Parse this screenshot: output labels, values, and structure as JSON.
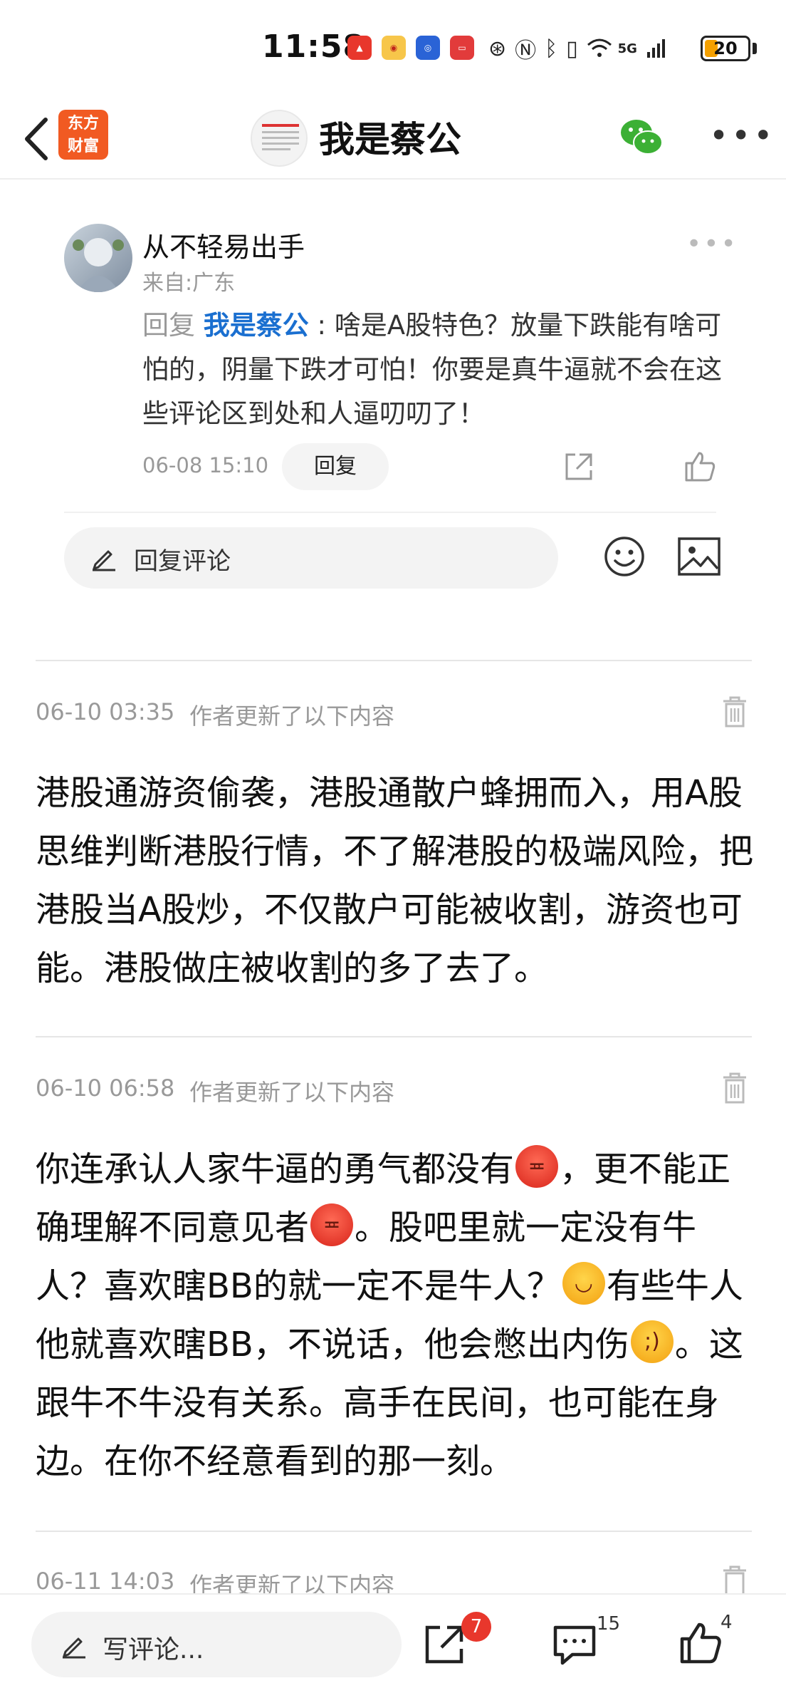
{
  "status_bar": {
    "time": "11:58",
    "battery": "20",
    "network": "5G",
    "app_icons": [
      "huawei-icon",
      "weibo-icon",
      "app-icon",
      "video-icon"
    ],
    "system_icons": [
      "nfc-icon",
      "n-icon",
      "bluetooth-icon",
      "vibrate-icon",
      "wifi-icon",
      "signal-icon"
    ]
  },
  "nav": {
    "brand": "东方\n财富",
    "title": "我是蔡公"
  },
  "reply_card": {
    "username": "从不轻易出手",
    "location": "来自:广东",
    "reply_prefix": "回复 ",
    "mention": "我是蔡公",
    "text": " : 啥是A股特色？放量下跌能有啥可怕的，阴量下跌才可怕！你要是真牛逼就不会在这些评论区到处和人逼叨叨了！",
    "date": "06-08 15:10",
    "reply_button": "回复"
  },
  "reply_input": {
    "placeholder": "回复评论"
  },
  "updates": [
    {
      "date": "06-10 03:35",
      "label": "作者更新了以下内容",
      "text": "港股通游资偷袭，港股通散户蜂拥而入，用A股思维判断港股行情，不了解港股的极端风险，把港股当A股炒，不仅散户可能被收割，游资也可能。港股做庄被收割的多了去了。"
    },
    {
      "date": "06-10 06:58",
      "label": "作者更新了以下内容",
      "parts": [
        "你连承认人家牛逼的勇气都没有",
        "，更不能正确理解不同意见者",
        "。股吧里就一定没有牛人？喜欢瞎BB的就一定不是牛人？",
        "有些牛人他就喜欢瞎BB，不说话，他会憋出内伤",
        "。这跟牛不牛没有关系。高手在民间，也可能在身边。在你不经意看到的那一刻。"
      ],
      "emojis": [
        "angry-emoji",
        "angry-emoji",
        "laugh-emoji",
        "wink-emoji"
      ]
    },
    {
      "date": "06-11 14:03",
      "label": "作者更新了以下内容"
    }
  ],
  "bottom_bar": {
    "comment_placeholder": "写评论...",
    "share_badge": "7",
    "comment_count": "15",
    "like_count": "4"
  },
  "colors": {
    "brand": "#f15a22",
    "mention": "#1a6fd0",
    "badge": "#e8372c",
    "wechat": "#3cb035"
  }
}
